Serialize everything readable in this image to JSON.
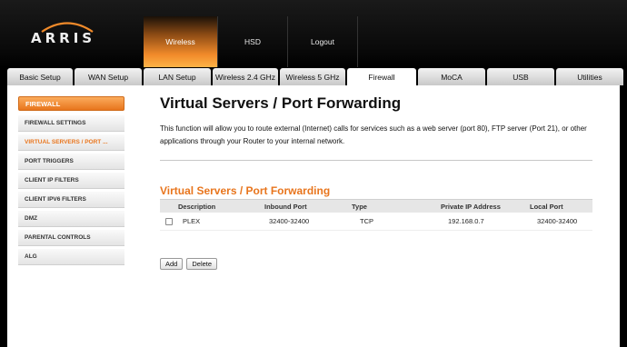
{
  "brand": {
    "name": "ARRIS",
    "accent": "#e8751d"
  },
  "topnav": {
    "items": [
      {
        "label": "Wireless",
        "active": true
      },
      {
        "label": "HSD",
        "active": false
      },
      {
        "label": "Logout",
        "active": false
      }
    ]
  },
  "tabs": [
    {
      "label": "Basic Setup",
      "active": false
    },
    {
      "label": "WAN Setup",
      "active": false
    },
    {
      "label": "LAN Setup",
      "active": false
    },
    {
      "label": "Wireless 2.4 GHz",
      "active": false
    },
    {
      "label": "Wireless 5 GHz",
      "active": false
    },
    {
      "label": "Firewall",
      "active": true
    },
    {
      "label": "MoCA",
      "active": false
    },
    {
      "label": "USB",
      "active": false
    },
    {
      "label": "Utilities",
      "active": false
    }
  ],
  "sidebar": {
    "header": "FIREWALL",
    "items": [
      {
        "label": "FIREWALL SETTINGS",
        "active": false
      },
      {
        "label": "VIRTUAL SERVERS / PORT ...",
        "active": true
      },
      {
        "label": "PORT TRIGGERS",
        "active": false
      },
      {
        "label": "CLIENT IP FILTERS",
        "active": false
      },
      {
        "label": "CLIENT IPV6 FILTERS",
        "active": false
      },
      {
        "label": "DMZ",
        "active": false
      },
      {
        "label": "PARENTAL CONTROLS",
        "active": false
      },
      {
        "label": "ALG",
        "active": false
      }
    ]
  },
  "main": {
    "title": "Virtual Servers / Port Forwarding",
    "intro": "This function will allow you to route external (Internet) calls for services such as a web server (port 80), FTP server (Port 21), or other applications through your Router to your internal network.",
    "section_title": "Virtual Servers / Port Forwarding",
    "columns": [
      "Description",
      "Inbound Port",
      "Type",
      "Private IP Address",
      "Local Port"
    ],
    "rows": [
      {
        "checked": false,
        "description": "PLEX",
        "inbound_port": "32400-32400",
        "type": "TCP",
        "private_ip": "192.168.0.7",
        "local_port": "32400-32400"
      }
    ],
    "buttons": {
      "add": "Add",
      "delete": "Delete"
    }
  }
}
